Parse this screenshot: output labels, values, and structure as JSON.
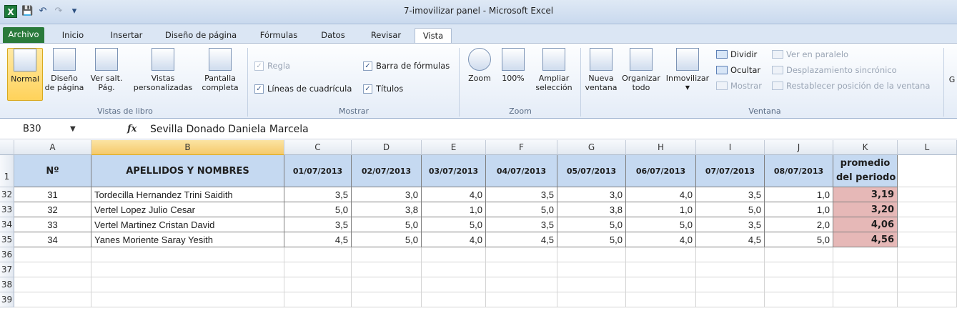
{
  "window": {
    "title": "7-imovilizar panel  -  Microsoft Excel",
    "app_icon": "X"
  },
  "tabs": [
    "Archivo",
    "Inicio",
    "Insertar",
    "Diseño de página",
    "Fórmulas",
    "Datos",
    "Revisar",
    "Vista"
  ],
  "active_tab": "Vista",
  "ribbon": {
    "vistas_libro": {
      "label": "Vistas de libro",
      "normal": "Normal",
      "diseno1": "Diseño",
      "diseno2": "de página",
      "versalt1": "Ver salt.",
      "versalt2": "Pág.",
      "vistas1": "Vistas",
      "vistas2": "personalizadas",
      "pantalla1": "Pantalla",
      "pantalla2": "completa"
    },
    "mostrar": {
      "label": "Mostrar",
      "regla": "Regla",
      "barra_formulas": "Barra de fórmulas",
      "lineas": "Líneas de cuadrícula",
      "titulos": "Títulos"
    },
    "zoom": {
      "label": "Zoom",
      "zoom": "Zoom",
      "cien": "100%",
      "ampliar1": "Ampliar",
      "ampliar2": "selección"
    },
    "ventana": {
      "label": "Ventana",
      "nueva1": "Nueva",
      "nueva2": "ventana",
      "organizar1": "Organizar",
      "organizar2": "todo",
      "inmovilizar": "Inmovilizar",
      "dividir": "Dividir",
      "ocultar": "Ocultar",
      "mostrar": "Mostrar",
      "paralelo": "Ver en paralelo",
      "sincronico": "Desplazamiento sincrónico",
      "restablecer": "Restablecer posición de la ventana",
      "extra": "G"
    }
  },
  "formula_bar": {
    "name_box": "B30",
    "fx": "fx",
    "content": "Sevilla Donado Daniela Marcela"
  },
  "grid": {
    "columns": [
      "A",
      "B",
      "C",
      "D",
      "E",
      "F",
      "G",
      "H",
      "I",
      "J",
      "K",
      "L"
    ],
    "selected_column": "B",
    "header_row": {
      "row_num": "1",
      "num": "Nº",
      "name": "APELLIDOS Y NOMBRES",
      "dates": [
        "01/07/2013",
        "02/07/2013",
        "03/07/2013",
        "04/07/2013",
        "05/07/2013",
        "06/07/2013",
        "07/07/2013",
        "08/07/2013"
      ],
      "avg1": "promedio",
      "avg2": "del periodo"
    },
    "rows": [
      {
        "row_num": "32",
        "num": "31",
        "name": "Tordecilla Hernandez Trini Saidith",
        "scores": [
          "3,5",
          "3,0",
          "4,0",
          "3,5",
          "3,0",
          "4,0",
          "3,5",
          "1,0"
        ],
        "avg": "3,19"
      },
      {
        "row_num": "33",
        "num": "32",
        "name": "Vertel Lopez Julio Cesar",
        "scores": [
          "5,0",
          "3,8",
          "1,0",
          "5,0",
          "3,8",
          "1,0",
          "5,0",
          "1,0"
        ],
        "avg": "3,20"
      },
      {
        "row_num": "34",
        "num": "33",
        "name": "Vertel Martinez Cristan David",
        "scores": [
          "3,5",
          "5,0",
          "5,0",
          "3,5",
          "5,0",
          "5,0",
          "3,5",
          "2,0"
        ],
        "avg": "4,06"
      },
      {
        "row_num": "35",
        "num": "34",
        "name": "Yanes Moriente Saray Yesith",
        "scores": [
          "4,5",
          "5,0",
          "4,0",
          "4,5",
          "5,0",
          "4,0",
          "4,5",
          "5,0"
        ],
        "avg": "4,56"
      }
    ],
    "empty_rows": [
      "36",
      "37",
      "38",
      "39"
    ]
  }
}
